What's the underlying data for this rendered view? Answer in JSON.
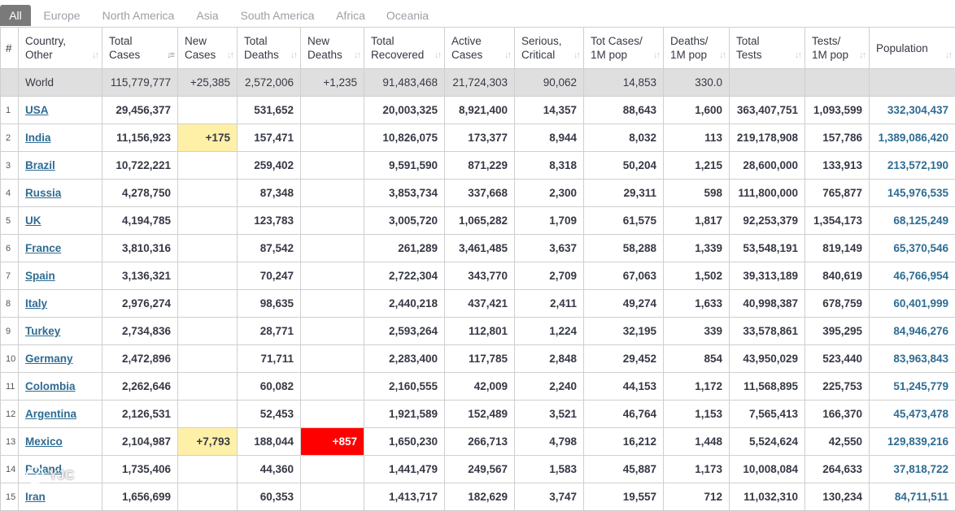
{
  "tabs": [
    "All",
    "Europe",
    "North America",
    "Asia",
    "South America",
    "Africa",
    "Oceania"
  ],
  "columns": [
    {
      "line1": "#",
      "line2": ""
    },
    {
      "line1": "Country,",
      "line2": "Other"
    },
    {
      "line1": "Total",
      "line2": "Cases"
    },
    {
      "line1": "New",
      "line2": "Cases"
    },
    {
      "line1": "Total",
      "line2": "Deaths"
    },
    {
      "line1": "New",
      "line2": "Deaths"
    },
    {
      "line1": "Total",
      "line2": "Recovered"
    },
    {
      "line1": "Active",
      "line2": "Cases"
    },
    {
      "line1": "Serious,",
      "line2": "Critical"
    },
    {
      "line1": "Tot Cases/",
      "line2": "1M pop"
    },
    {
      "line1": "Deaths/",
      "line2": "1M pop"
    },
    {
      "line1": "Total",
      "line2": "Tests"
    },
    {
      "line1": "Tests/",
      "line2": "1M pop"
    },
    {
      "line1": "Population",
      "line2": ""
    }
  ],
  "world": {
    "country": "World",
    "total_cases": "115,779,777",
    "new_cases": "+25,385",
    "total_deaths": "2,572,006",
    "new_deaths": "+1,235",
    "total_recovered": "91,483,468",
    "active_cases": "21,724,303",
    "serious": "90,062",
    "cases_per_m": "14,853",
    "deaths_per_m": "330.0",
    "total_tests": "",
    "tests_per_m": "",
    "population": ""
  },
  "rows": [
    {
      "idx": "1",
      "country": "USA",
      "total_cases": "29,456,377",
      "new_cases": "",
      "total_deaths": "531,652",
      "new_deaths": "",
      "total_recovered": "20,003,325",
      "active_cases": "8,921,400",
      "serious": "14,357",
      "cases_per_m": "88,643",
      "deaths_per_m": "1,600",
      "total_tests": "363,407,751",
      "tests_per_m": "1,093,599",
      "population": "332,304,437"
    },
    {
      "idx": "2",
      "country": "India",
      "total_cases": "11,156,923",
      "new_cases": "+175",
      "total_deaths": "157,471",
      "new_deaths": "",
      "total_recovered": "10,826,075",
      "active_cases": "173,377",
      "serious": "8,944",
      "cases_per_m": "8,032",
      "deaths_per_m": "113",
      "total_tests": "219,178,908",
      "tests_per_m": "157,786",
      "population": "1,389,086,420"
    },
    {
      "idx": "3",
      "country": "Brazil",
      "total_cases": "10,722,221",
      "new_cases": "",
      "total_deaths": "259,402",
      "new_deaths": "",
      "total_recovered": "9,591,590",
      "active_cases": "871,229",
      "serious": "8,318",
      "cases_per_m": "50,204",
      "deaths_per_m": "1,215",
      "total_tests": "28,600,000",
      "tests_per_m": "133,913",
      "population": "213,572,190"
    },
    {
      "idx": "4",
      "country": "Russia",
      "total_cases": "4,278,750",
      "new_cases": "",
      "total_deaths": "87,348",
      "new_deaths": "",
      "total_recovered": "3,853,734",
      "active_cases": "337,668",
      "serious": "2,300",
      "cases_per_m": "29,311",
      "deaths_per_m": "598",
      "total_tests": "111,800,000",
      "tests_per_m": "765,877",
      "population": "145,976,535"
    },
    {
      "idx": "5",
      "country": "UK",
      "total_cases": "4,194,785",
      "new_cases": "",
      "total_deaths": "123,783",
      "new_deaths": "",
      "total_recovered": "3,005,720",
      "active_cases": "1,065,282",
      "serious": "1,709",
      "cases_per_m": "61,575",
      "deaths_per_m": "1,817",
      "total_tests": "92,253,379",
      "tests_per_m": "1,354,173",
      "population": "68,125,249"
    },
    {
      "idx": "6",
      "country": "France",
      "total_cases": "3,810,316",
      "new_cases": "",
      "total_deaths": "87,542",
      "new_deaths": "",
      "total_recovered": "261,289",
      "active_cases": "3,461,485",
      "serious": "3,637",
      "cases_per_m": "58,288",
      "deaths_per_m": "1,339",
      "total_tests": "53,548,191",
      "tests_per_m": "819,149",
      "population": "65,370,546"
    },
    {
      "idx": "7",
      "country": "Spain",
      "total_cases": "3,136,321",
      "new_cases": "",
      "total_deaths": "70,247",
      "new_deaths": "",
      "total_recovered": "2,722,304",
      "active_cases": "343,770",
      "serious": "2,709",
      "cases_per_m": "67,063",
      "deaths_per_m": "1,502",
      "total_tests": "39,313,189",
      "tests_per_m": "840,619",
      "population": "46,766,954"
    },
    {
      "idx": "8",
      "country": "Italy",
      "total_cases": "2,976,274",
      "new_cases": "",
      "total_deaths": "98,635",
      "new_deaths": "",
      "total_recovered": "2,440,218",
      "active_cases": "437,421",
      "serious": "2,411",
      "cases_per_m": "49,274",
      "deaths_per_m": "1,633",
      "total_tests": "40,998,387",
      "tests_per_m": "678,759",
      "population": "60,401,999"
    },
    {
      "idx": "9",
      "country": "Turkey",
      "total_cases": "2,734,836",
      "new_cases": "",
      "total_deaths": "28,771",
      "new_deaths": "",
      "total_recovered": "2,593,264",
      "active_cases": "112,801",
      "serious": "1,224",
      "cases_per_m": "32,195",
      "deaths_per_m": "339",
      "total_tests": "33,578,861",
      "tests_per_m": "395,295",
      "population": "84,946,276"
    },
    {
      "idx": "10",
      "country": "Germany",
      "total_cases": "2,472,896",
      "new_cases": "",
      "total_deaths": "71,711",
      "new_deaths": "",
      "total_recovered": "2,283,400",
      "active_cases": "117,785",
      "serious": "2,848",
      "cases_per_m": "29,452",
      "deaths_per_m": "854",
      "total_tests": "43,950,029",
      "tests_per_m": "523,440",
      "population": "83,963,843"
    },
    {
      "idx": "11",
      "country": "Colombia",
      "total_cases": "2,262,646",
      "new_cases": "",
      "total_deaths": "60,082",
      "new_deaths": "",
      "total_recovered": "2,160,555",
      "active_cases": "42,009",
      "serious": "2,240",
      "cases_per_m": "44,153",
      "deaths_per_m": "1,172",
      "total_tests": "11,568,895",
      "tests_per_m": "225,753",
      "population": "51,245,779"
    },
    {
      "idx": "12",
      "country": "Argentina",
      "total_cases": "2,126,531",
      "new_cases": "",
      "total_deaths": "52,453",
      "new_deaths": "",
      "total_recovered": "1,921,589",
      "active_cases": "152,489",
      "serious": "3,521",
      "cases_per_m": "46,764",
      "deaths_per_m": "1,153",
      "total_tests": "7,565,413",
      "tests_per_m": "166,370",
      "population": "45,473,478"
    },
    {
      "idx": "13",
      "country": "Mexico",
      "total_cases": "2,104,987",
      "new_cases": "+7,793",
      "total_deaths": "188,044",
      "new_deaths": "+857",
      "total_recovered": "1,650,230",
      "active_cases": "266,713",
      "serious": "4,798",
      "cases_per_m": "16,212",
      "deaths_per_m": "1,448",
      "total_tests": "5,524,624",
      "tests_per_m": "42,550",
      "population": "129,839,216"
    },
    {
      "idx": "14",
      "country": "Poland",
      "total_cases": "1,735,406",
      "new_cases": "",
      "total_deaths": "44,360",
      "new_deaths": "",
      "total_recovered": "1,441,479",
      "active_cases": "249,567",
      "serious": "1,583",
      "cases_per_m": "45,887",
      "deaths_per_m": "1,173",
      "total_tests": "10,008,084",
      "tests_per_m": "264,633",
      "population": "37,818,722"
    },
    {
      "idx": "15",
      "country": "Iran",
      "total_cases": "1,656,699",
      "new_cases": "",
      "total_deaths": "60,353",
      "new_deaths": "",
      "total_recovered": "1,413,717",
      "active_cases": "182,629",
      "serious": "3,747",
      "cases_per_m": "19,557",
      "deaths_per_m": "712",
      "total_tests": "11,032,310",
      "tests_per_m": "130,234",
      "population": "84,711,511"
    }
  ],
  "watermark": "YJC",
  "colors": {
    "new_cases_highlight": "#fff0a8",
    "new_deaths_highlight": "#ff0000",
    "link": "#2e6c93",
    "world_row": "#dfdfdf",
    "active_tab": "#7a7a7a"
  }
}
